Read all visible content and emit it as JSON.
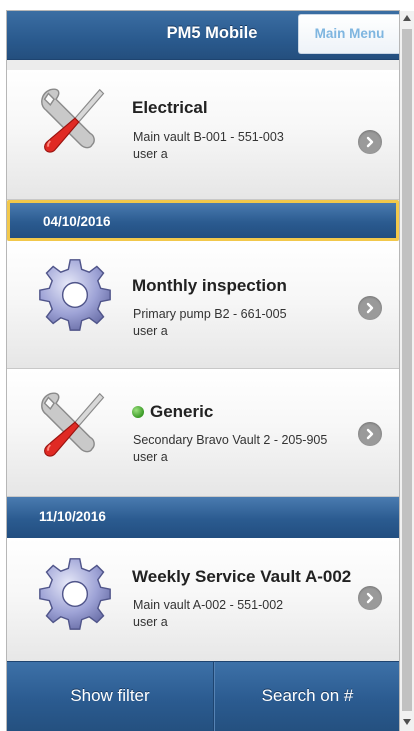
{
  "header": {
    "title": "PM5 Mobile",
    "menu_label": "Main Menu"
  },
  "items": [
    {
      "title": "Electrical",
      "location": "Main vault B-001 - 551-003",
      "user": "user a",
      "icon": "tools-icon",
      "status": ""
    },
    {
      "title": "Monthly inspection",
      "location": "Primary pump B2 - 661-005",
      "user": "user a",
      "icon": "gear-icon",
      "status": ""
    },
    {
      "title": "Generic",
      "location": "Secondary Bravo Vault 2 - 205-905",
      "user": "user a",
      "icon": "tools-icon",
      "status": "green"
    },
    {
      "title": "Weekly Service Vault A-002",
      "location": "Main vault A-002 - 551-002",
      "user": "user a",
      "icon": "gear-icon",
      "status": ""
    }
  ],
  "dividers": [
    "04/10/2016",
    "11/10/2016"
  ],
  "footer": {
    "filter_label": "Show filter",
    "search_label": "Search on #"
  },
  "colors": {
    "header_blue": "#2a5a8e",
    "selected_border": "#f2c84b",
    "status_green": "#3a9a26"
  }
}
